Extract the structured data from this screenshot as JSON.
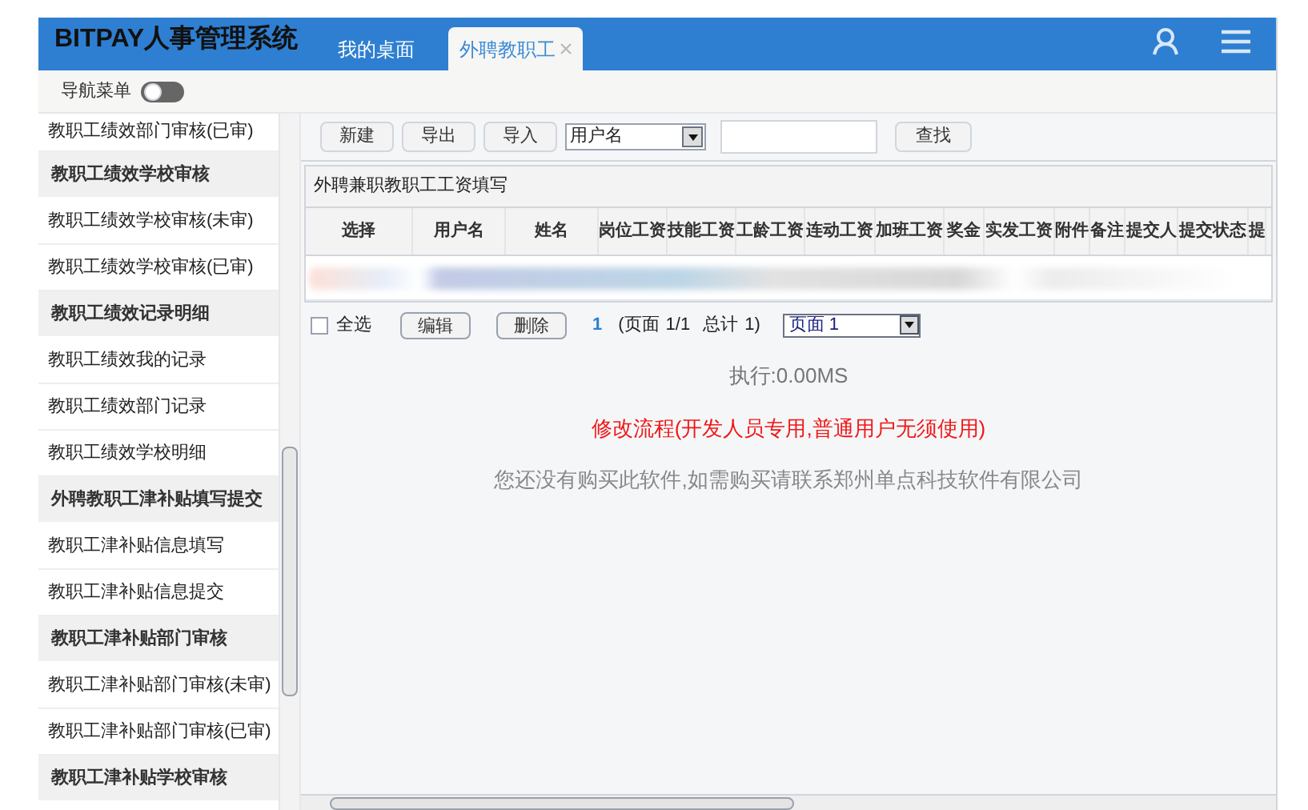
{
  "header": {
    "title": "BITPAY人事管理系统",
    "tabs": [
      {
        "label": "我的桌面",
        "selected": false,
        "closable": false
      },
      {
        "label": "外聘教职工",
        "selected": true,
        "closable": true
      }
    ]
  },
  "nav": {
    "label": "导航菜单",
    "toggle_on": false
  },
  "sidebar": {
    "items": [
      {
        "kind": "link",
        "label": "教职工绩效部门审核(已审)"
      },
      {
        "kind": "header",
        "label": "教职工绩效学校审核"
      },
      {
        "kind": "link",
        "label": "教职工绩效学校审核(未审)"
      },
      {
        "kind": "link",
        "label": "教职工绩效学校审核(已审)"
      },
      {
        "kind": "header",
        "label": "教职工绩效记录明细"
      },
      {
        "kind": "link",
        "label": "教职工绩效我的记录"
      },
      {
        "kind": "link",
        "label": "教职工绩效部门记录"
      },
      {
        "kind": "link",
        "label": "教职工绩效学校明细"
      },
      {
        "kind": "header",
        "label": "外聘教职工津补贴填写提交"
      },
      {
        "kind": "link",
        "label": "教职工津补贴信息填写"
      },
      {
        "kind": "link",
        "label": "教职工津补贴信息提交"
      },
      {
        "kind": "header",
        "label": "教职工津补贴部门审核"
      },
      {
        "kind": "link",
        "label": "教职工津补贴部门审核(未审)"
      },
      {
        "kind": "link",
        "label": "教职工津补贴部门审核(已审)"
      },
      {
        "kind": "header",
        "label": "教职工津补贴学校审核"
      }
    ]
  },
  "toolbar": {
    "buttons": [
      "新建",
      "导出",
      "导入"
    ],
    "filter_select": "用户名",
    "search_button": "查找"
  },
  "panel": {
    "title": "外聘兼职教职工工资填写",
    "columns": [
      "选择",
      "用户名",
      "姓名",
      "岗位工资",
      "技能工资",
      "工龄工资",
      "连动工资",
      "加班工资",
      "奖金",
      "实发工资",
      "附件",
      "备注",
      "提交人",
      "提交状态",
      "提"
    ],
    "footer": {
      "select_all": {
        "label": "全选",
        "checked": false
      },
      "buttons": [
        "编辑",
        "删除"
      ],
      "current_page": "1",
      "page_label": "(页面",
      "page_count": "1/1",
      "total_label": "总计",
      "total": "1)",
      "page_select": "页面 1"
    }
  },
  "messages": [
    {
      "kind": "info",
      "text": "执行:0.00MS"
    },
    {
      "kind": "warning",
      "text": "修改流程(开发人员专用,普通用户无须使用)"
    },
    {
      "kind": "notice",
      "text": "您还没有购买此软件,如需购买请联系郑州单点科技软件有限公司"
    }
  ]
}
